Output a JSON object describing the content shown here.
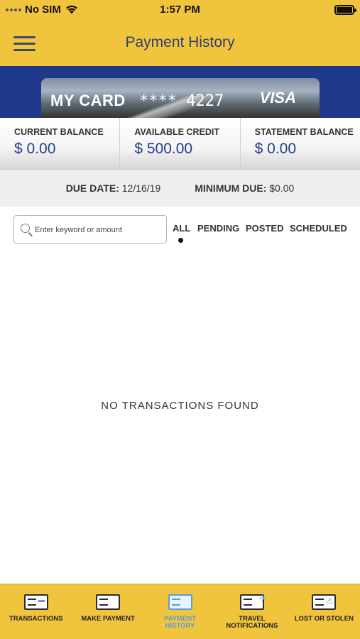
{
  "status": {
    "carrier": "No SIM",
    "time": "1:57 PM"
  },
  "nav": {
    "title": "Payment History"
  },
  "card": {
    "label": "MY CARD",
    "number": "**** 4227",
    "brand": "VISA"
  },
  "balances": [
    {
      "label": "CURRENT BALANCE",
      "value": "$ 0.00"
    },
    {
      "label": "AVAILABLE CREDIT",
      "value": "$ 500.00"
    },
    {
      "label": "STATEMENT BALANCE",
      "value": "$ 0.00"
    }
  ],
  "due": {
    "date_label": "DUE DATE:",
    "date": "12/16/19",
    "min_label": "MINIMUM DUE:",
    "min": "$0.00"
  },
  "search": {
    "placeholder": "Enter keyword or amount"
  },
  "filters": {
    "all": "ALL",
    "pending": "PENDING",
    "posted": "POSTED",
    "scheduled": "SCHEDULED",
    "selected": "ALL"
  },
  "empty_message": "NO TRANSACTIONS FOUND",
  "tabs": [
    {
      "label": "TRANSACTIONS",
      "icon": "card-arrow-icon"
    },
    {
      "label": "MAKE PAYMENT",
      "icon": "card-icon"
    },
    {
      "label": "PAYMENT HISTORY",
      "icon": "calendar-card-icon",
      "active": true
    },
    {
      "label": "TRAVEL NOTIFICATIONS",
      "icon": "card-plane-icon"
    },
    {
      "label": "LOST OR STOLEN",
      "icon": "card-warning-icon"
    }
  ],
  "colors": {
    "header": "#f1c43d",
    "band": "#1f3a8a",
    "accent_blue": "#22408a",
    "active_tab": "#5a9bd8"
  }
}
